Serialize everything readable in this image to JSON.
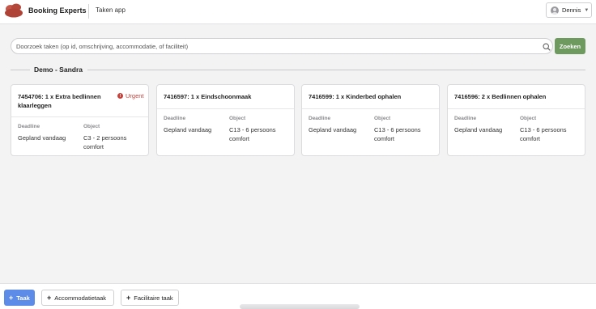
{
  "header": {
    "brand": "Booking Experts",
    "app_name": "Taken app",
    "user": {
      "name": "Dennis",
      "icon": "user-avatar-icon",
      "caret_icon": "chevron-down-icon"
    },
    "logo_color": "#b5473a"
  },
  "search": {
    "placeholder": "Doorzoek taken (op id, omschrijving, accommodatie, of faciliteit)",
    "value": "",
    "icon": "search-icon",
    "button_label": "Zoeken",
    "button_color": "#6e9a5f"
  },
  "group": {
    "title": "Demo - Sandra",
    "tasks": [
      {
        "title": "7454706: 1 x Extra bedlinnen klaarleggen",
        "urgent": true,
        "urgent_label": "Urgent",
        "deadline_label": "Deadline",
        "deadline": "Gepland vandaag",
        "object_label": "Object",
        "object": "C3 - 2 persoons comfort"
      },
      {
        "title": "7416597: 1 x Eindschoonmaak",
        "urgent": false,
        "deadline_label": "Deadline",
        "deadline": "Gepland vandaag",
        "object_label": "Object",
        "object": "C13 - 6 persoons comfort"
      },
      {
        "title": "7416599: 1 x Kinderbed ophalen",
        "urgent": false,
        "deadline_label": "Deadline",
        "deadline": "Gepland vandaag",
        "object_label": "Object",
        "object": "C13 - 6 persoons comfort"
      },
      {
        "title": "7416596: 2 x Bedlinnen ophalen",
        "urgent": false,
        "deadline_label": "Deadline",
        "deadline": "Gepland vandaag",
        "object_label": "Object",
        "object": "C13 - 6 persoons comfort"
      }
    ]
  },
  "footer": {
    "buttons": [
      {
        "label": "Taak",
        "icon": "plus-icon",
        "style": "primary",
        "color": "#5d8ce8"
      },
      {
        "label": "Accommodatietaak",
        "icon": "plus-icon",
        "style": "secondary"
      },
      {
        "label": "Facilitaire taak",
        "icon": "plus-icon",
        "style": "secondary"
      }
    ]
  },
  "colors": {
    "urgent": "#c5423b",
    "background": "#f3f3f4"
  }
}
